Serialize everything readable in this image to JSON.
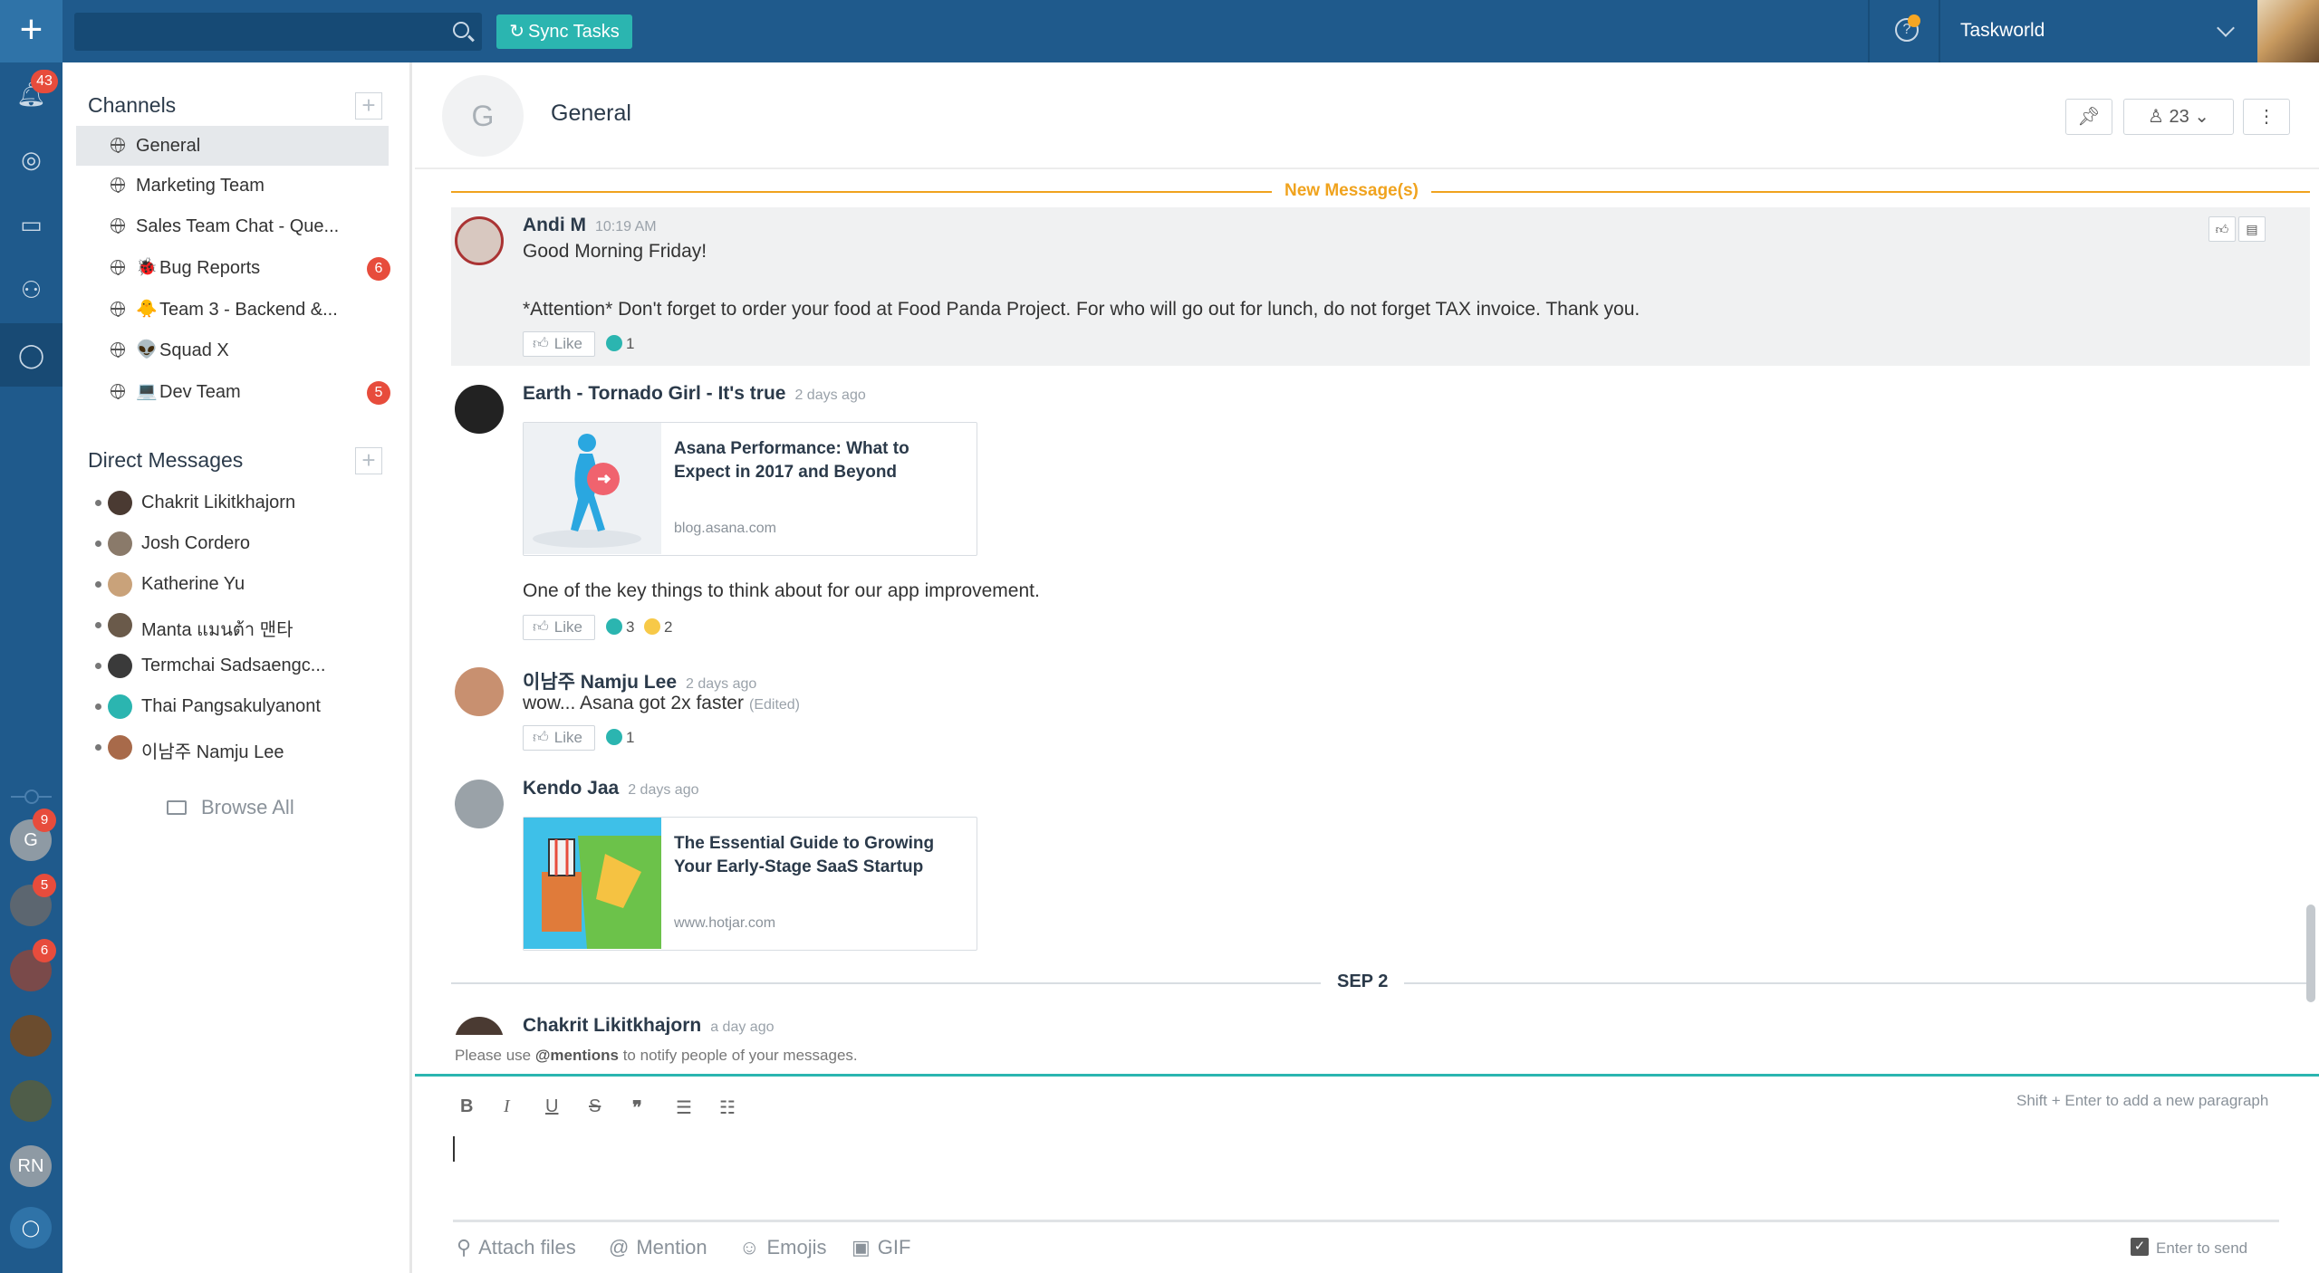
{
  "topbar": {
    "search_placeholder": "",
    "sync_label": "Sync Tasks",
    "sync_icon": "↻",
    "workspace_name": "Taskworld",
    "help_icon": "?"
  },
  "rail": {
    "notifications_count": "43",
    "workspaces": [
      {
        "initials": "G",
        "badge": "9",
        "color": "#8e9aa4"
      },
      {
        "initials": "",
        "badge": "5",
        "color": "#5c6670"
      },
      {
        "initials": "",
        "badge": "6",
        "color": "#7a4a4a"
      },
      {
        "initials": "",
        "badge": "",
        "color": "#6b4c2e"
      },
      {
        "initials": "",
        "badge": "",
        "color": "#4f5d49"
      },
      {
        "initials": "RN",
        "badge": "",
        "color": "#8e9aa4"
      }
    ]
  },
  "sidebar": {
    "channels_title": "Channels",
    "channels": [
      {
        "label": "General",
        "emoji": "",
        "badge": ""
      },
      {
        "label": "Marketing Team",
        "emoji": "",
        "badge": ""
      },
      {
        "label": "Sales Team Chat - Que...",
        "emoji": "",
        "badge": ""
      },
      {
        "label": "Bug Reports",
        "emoji": "🐞",
        "badge": "6"
      },
      {
        "label": "Team 3 - Backend &...",
        "emoji": "🐥",
        "badge": ""
      },
      {
        "label": "Squad X",
        "emoji": "👽",
        "badge": ""
      },
      {
        "label": "Dev Team",
        "emoji": "💻",
        "badge": "5"
      }
    ],
    "dm_title": "Direct Messages",
    "dms": [
      {
        "label": "Chakrit Likitkhajorn",
        "color": "#4a3a32"
      },
      {
        "label": "Josh Cordero",
        "color": "#8a7a6a"
      },
      {
        "label": "Katherine Yu",
        "color": "#c9a27a"
      },
      {
        "label": "Manta แมนต้า 맨타",
        "color": "#6a5a4a"
      },
      {
        "label": "Termchai Sadsaengc...",
        "color": "#3a3a3a"
      },
      {
        "label": "Thai Pangsakulyanont",
        "color": "#2bb5b0"
      },
      {
        "label": "이남주 Namju Lee",
        "color": "#a86a4a"
      }
    ],
    "browse_all": "Browse All"
  },
  "channel": {
    "initial": "G",
    "title": "General",
    "members": "23"
  },
  "new_messages_label": "New Message(s)",
  "messages": [
    {
      "author": "Andi M",
      "time": "10:19 AM",
      "line1": "Good Morning Friday!",
      "line2": "*Attention* Don't forget to order your food at Food Panda Project. For who will go out for lunch, do not forget TAX invoice. Thank you.",
      "like": "Like",
      "likes": "1"
    },
    {
      "author": "Earth - Tornado Girl - It's true",
      "time": "2 days ago",
      "card_title": "Asana Performance: What to Expect in 2017 and Beyond",
      "card_domain": "blog.asana.com",
      "text": "One of the key things to think about for our app improvement.",
      "like": "Like",
      "likes": "3",
      "sad": "2"
    },
    {
      "author": "이남주 Namju Lee",
      "time": "2 days ago",
      "text": "wow... Asana got 2x faster",
      "edited": "(Edited)",
      "like": "Like",
      "likes": "1"
    },
    {
      "author": "Kendo Jaa",
      "time": "2 days ago",
      "card_title": "The Essential Guide to Growing Your Early-Stage SaaS Startup",
      "card_domain": "www.hotjar.com"
    },
    {
      "author": "Chakrit Likitkhajorn",
      "time": "a day ago"
    }
  ],
  "date_separator": "SEP 2",
  "composer": {
    "mention_prefix": "Please use ",
    "mention_bold": "@mentions",
    "mention_suffix": " to notify people of your messages.",
    "shift_hint": "Shift + Enter to add a new paragraph",
    "attach": "Attach files",
    "mention": "Mention",
    "emojis": "Emojis",
    "gif": "GIF",
    "enter_to_send": "Enter to send"
  }
}
